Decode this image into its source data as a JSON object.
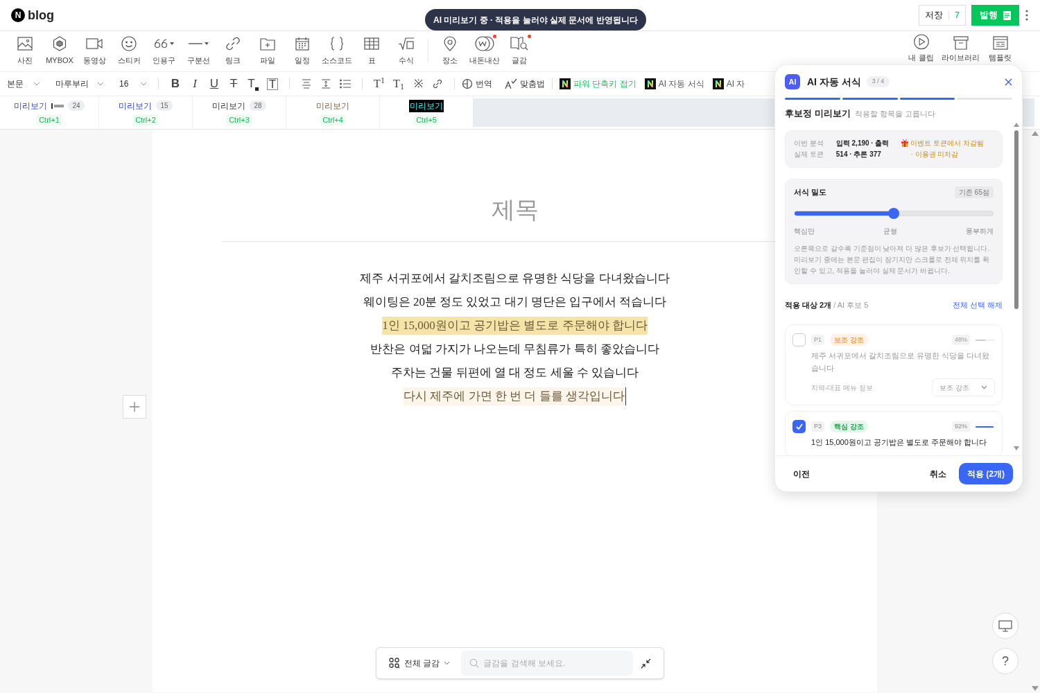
{
  "header": {
    "logo_mark": "N",
    "logo": "blog",
    "toast": "AI 미리보기 중 · 적용을 눌러야 실제 문서에 반영됩니다",
    "save": "저장",
    "save_count": "7",
    "publish": "발행"
  },
  "toolbar": {
    "items": [
      {
        "label": "사진",
        "dropdown": false,
        "dot": false
      },
      {
        "label": "MYBOX",
        "dropdown": false,
        "dot": false
      },
      {
        "label": "동영상",
        "dropdown": false,
        "dot": false
      },
      {
        "label": "스티커",
        "dropdown": false,
        "dot": false
      },
      {
        "label": "인용구",
        "dropdown": true,
        "dot": false
      },
      {
        "label": "구분선",
        "dropdown": true,
        "dot": false
      },
      {
        "label": "링크",
        "dropdown": false,
        "dot": false
      },
      {
        "label": "파일",
        "dropdown": false,
        "dot": false
      },
      {
        "label": "일정",
        "dropdown": false,
        "dot": false
      },
      {
        "label": "소스코드",
        "dropdown": false,
        "dot": false
      },
      {
        "label": "표",
        "dropdown": false,
        "dot": false
      },
      {
        "label": "수식",
        "dropdown": false,
        "dot": false
      },
      {
        "label": "장소",
        "dropdown": false,
        "dot": false
      },
      {
        "label": "내돈내산",
        "dropdown": false,
        "dot": true
      },
      {
        "label": "글감",
        "dropdown": false,
        "dot": true
      }
    ],
    "right_items": [
      {
        "label": "내 클립"
      },
      {
        "label": "라이브러리"
      },
      {
        "label": "템플릿"
      }
    ]
  },
  "format_bar": {
    "dropdowns": [
      "본문",
      "마루부리",
      "16"
    ],
    "text_buttons": [
      "B",
      "I",
      "U",
      "T",
      "T",
      "T"
    ],
    "script_buttons": [
      "T$^{1}$",
      "T$_{1}$",
      "※"
    ],
    "translate": "번역",
    "spellcheck": "맞춤법",
    "ai_buttons": [
      {
        "label": "파워 단축키 접기",
        "active": true
      },
      {
        "label": "AI 자동 서식",
        "active": false
      },
      {
        "label": "AI 자",
        "active": false
      }
    ]
  },
  "preview_styles": [
    {
      "label": "미리보기",
      "kind": "marker",
      "count": "24",
      "shortcut": "Ctrl+1"
    },
    {
      "label": "미리보기",
      "kind": "link",
      "count": "15",
      "shortcut": "Ctrl+2"
    },
    {
      "label": "미리보기",
      "kind": "plain",
      "count": "28",
      "shortcut": "Ctrl+3"
    },
    {
      "label": "미리보기",
      "kind": "warm",
      "shortcut": "Ctrl+4"
    },
    {
      "label": "미리보기",
      "kind": "inverse",
      "shortcut": "Ctrl+5"
    }
  ],
  "document": {
    "title": "제목",
    "paragraphs": [
      {
        "text": "제주 서귀포에서 갈치조림으로 유명한 식당을 다녀왔습니다",
        "kind": "plain",
        "caret": false
      },
      {
        "text": "웨이팅은 20분 정도 있었고 대기 명단은 입구에서 적습니다",
        "kind": "plain",
        "caret": false
      },
      {
        "text": "1인 15,000원이고 공기밥은 별도로 주문해야 합니다",
        "kind": "highlighted",
        "caret": false
      },
      {
        "text": "반찬은 여덟 가지가 나오는데 무침류가 특히 좋았습니다",
        "kind": "plain",
        "caret": false
      },
      {
        "text": "주차는 건물 뒤편에 열 대 정도 세울 수 있습니다",
        "kind": "plain",
        "caret": false
      },
      {
        "text": "다시 제주에 가면 한 번 더 들를 생각입니다",
        "kind": "tinted",
        "caret": true
      }
    ]
  },
  "bottom_bar": {
    "category": "전체 글감",
    "search_placeholder": "글감을 검색해 보세요."
  },
  "help": "?",
  "ai_panel": {
    "badge": "AI",
    "title": "AI 자동 서식",
    "step": "3 / 4",
    "steps": [
      {
        "done": true
      },
      {
        "done": true
      },
      {
        "done": true
      },
      {
        "done": false
      }
    ],
    "section_title": "후보정 미리보기",
    "section_hint": "적용할 항목을 고릅니다",
    "tokens": {
      "labels": [
        "이번 분석",
        "실제 토큰"
      ],
      "values": [
        "입력 2,190 · 출력",
        "514 · 추론 377"
      ],
      "notice": "이벤트 토큰에서 차감됨 · 이용권 미차감"
    },
    "density": {
      "title": "서식 밀도",
      "badge": "기존 65점",
      "level": 0.5,
      "scale": [
        "핵심만",
        "균형",
        "풍부하게"
      ],
      "description": "오른쪽으로 갈수록 기준점이 낮아져 더 많은 후보가 선택됩니다. 미리보기 중에는 본문 편집이 잠기지만 스크롤로 전체 위치를 확인할 수 있고, 적용을 눌러야 실제 문서가 바뀝니다."
    },
    "targets": {
      "count": "적용 대상 2개",
      "total": "/ AI 후보 5",
      "clear": "전체 선택 해제"
    },
    "candidates": [
      {
        "checked": false,
        "index": "P1",
        "tag": "보조 강조",
        "kind": "support",
        "confidence": "48%",
        "level": 0.5,
        "text": "제주 서귀포에서 갈치조림으로 유명한 식당을 다녀왔습니다",
        "note": "지역-대표 메뉴 정보",
        "choice": "보조 강조"
      },
      {
        "checked": true,
        "index": "P3",
        "tag": "핵심 강조",
        "kind": "core",
        "confidence": "92%",
        "level": 0.92,
        "text": "1인 15,000원이고 공기밥은 별도로 주문해야 합니다"
      }
    ],
    "footer": {
      "back": "이전",
      "cancel": "취소",
      "apply": "적용 (2개)"
    }
  }
}
